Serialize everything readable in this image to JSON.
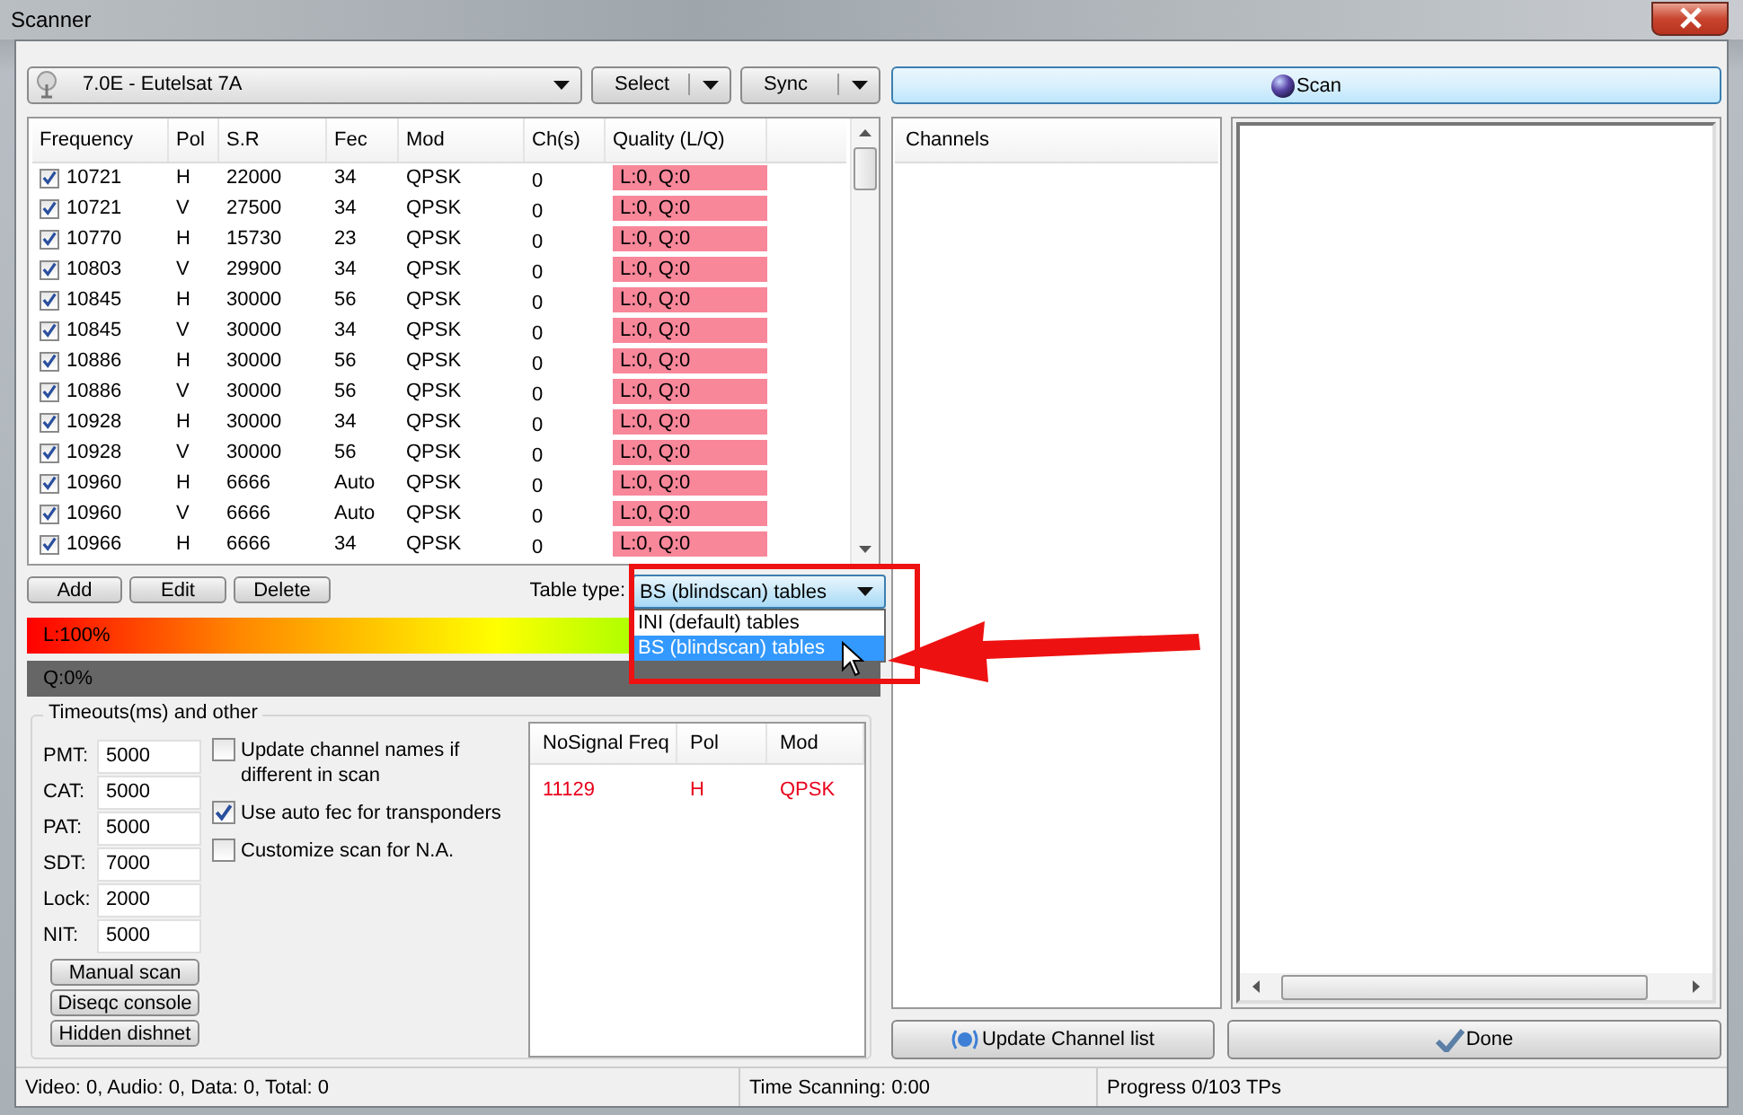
{
  "window": {
    "title": "Scanner"
  },
  "satellite": {
    "value": "7.0E - Eutelsat 7A"
  },
  "select_button": "Select",
  "sync_button": "Sync",
  "scan_button": "Scan",
  "transponders": {
    "columns": [
      "Frequency",
      "Pol",
      "S.R",
      "Fec",
      "Mod",
      "Ch(s)",
      "Quality (L/Q)"
    ],
    "rows": [
      {
        "checked": true,
        "frequency": "10721",
        "pol": "H",
        "sr": "22000",
        "fec": "34",
        "mod": "QPSK",
        "channels": "0",
        "quality": "L:0, Q:0"
      },
      {
        "checked": true,
        "frequency": "10721",
        "pol": "V",
        "sr": "27500",
        "fec": "34",
        "mod": "QPSK",
        "channels": "0",
        "quality": "L:0, Q:0"
      },
      {
        "checked": true,
        "frequency": "10770",
        "pol": "H",
        "sr": "15730",
        "fec": "23",
        "mod": "QPSK",
        "channels": "0",
        "quality": "L:0, Q:0"
      },
      {
        "checked": true,
        "frequency": "10803",
        "pol": "V",
        "sr": "29900",
        "fec": "34",
        "mod": "QPSK",
        "channels": "0",
        "quality": "L:0, Q:0"
      },
      {
        "checked": true,
        "frequency": "10845",
        "pol": "H",
        "sr": "30000",
        "fec": "56",
        "mod": "QPSK",
        "channels": "0",
        "quality": "L:0, Q:0"
      },
      {
        "checked": true,
        "frequency": "10845",
        "pol": "V",
        "sr": "30000",
        "fec": "34",
        "mod": "QPSK",
        "channels": "0",
        "quality": "L:0, Q:0"
      },
      {
        "checked": true,
        "frequency": "10886",
        "pol": "H",
        "sr": "30000",
        "fec": "56",
        "mod": "QPSK",
        "channels": "0",
        "quality": "L:0, Q:0"
      },
      {
        "checked": true,
        "frequency": "10886",
        "pol": "V",
        "sr": "30000",
        "fec": "56",
        "mod": "QPSK",
        "channels": "0",
        "quality": "L:0, Q:0"
      },
      {
        "checked": true,
        "frequency": "10928",
        "pol": "H",
        "sr": "30000",
        "fec": "34",
        "mod": "QPSK",
        "channels": "0",
        "quality": "L:0, Q:0"
      },
      {
        "checked": true,
        "frequency": "10928",
        "pol": "V",
        "sr": "30000",
        "fec": "56",
        "mod": "QPSK",
        "channels": "0",
        "quality": "L:0, Q:0"
      },
      {
        "checked": true,
        "frequency": "10960",
        "pol": "H",
        "sr": "6666",
        "fec": "Auto",
        "mod": "QPSK",
        "channels": "0",
        "quality": "L:0, Q:0"
      },
      {
        "checked": true,
        "frequency": "10960",
        "pol": "V",
        "sr": "6666",
        "fec": "Auto",
        "mod": "QPSK",
        "channels": "0",
        "quality": "L:0, Q:0"
      },
      {
        "checked": true,
        "frequency": "10966",
        "pol": "H",
        "sr": "6666",
        "fec": "34",
        "mod": "QPSK",
        "channels": "0",
        "quality": "L:0, Q:0"
      }
    ]
  },
  "list_buttons": [
    "Add",
    "Edit",
    "Delete"
  ],
  "table_type": {
    "label": "Table type:",
    "value": "BS (blindscan) tables",
    "expanded": true,
    "options": [
      {
        "label": "INI (default) tables",
        "selected": false
      },
      {
        "label": "BS (blindscan) tables",
        "selected": true
      }
    ]
  },
  "level_bar": {
    "label": "L:100%",
    "level": 1
  },
  "quality_bar": {
    "label": "Q:0%",
    "level": 0
  },
  "timeouts": {
    "title": "Timeouts(ms) and other",
    "fields": [
      {
        "label": "PMT:",
        "value": "5000"
      },
      {
        "label": "CAT:",
        "value": "5000"
      },
      {
        "label": "PAT:",
        "value": "5000"
      },
      {
        "label": "SDT:",
        "value": "7000"
      },
      {
        "label": "Lock:",
        "value": "2000"
      },
      {
        "label": "NIT:",
        "value": "5000"
      }
    ],
    "options": [
      {
        "label": "Update channel names if different in scan",
        "checked": false
      },
      {
        "label": "Use auto fec for transponders",
        "checked": true
      },
      {
        "label": "Customize scan for N.A.",
        "checked": false
      }
    ],
    "buttons": [
      "Manual scan",
      "Diseqc console",
      "Hidden dishnet"
    ]
  },
  "no_signal": {
    "columns": [
      "NoSignal Freq",
      "Pol",
      "Mod"
    ],
    "rows": [
      {
        "frequency": "11129",
        "pol": "H",
        "mod": "QPSK"
      }
    ]
  },
  "channels_panel": {
    "header": "Channels"
  },
  "update_button": "Update Channel list",
  "done_button": "Done",
  "status_bar": [
    "Video: 0, Audio: 0, Data: 0, Total: 0",
    "Time Scanning: 0:00",
    "Progress 0/103 TPs"
  ]
}
